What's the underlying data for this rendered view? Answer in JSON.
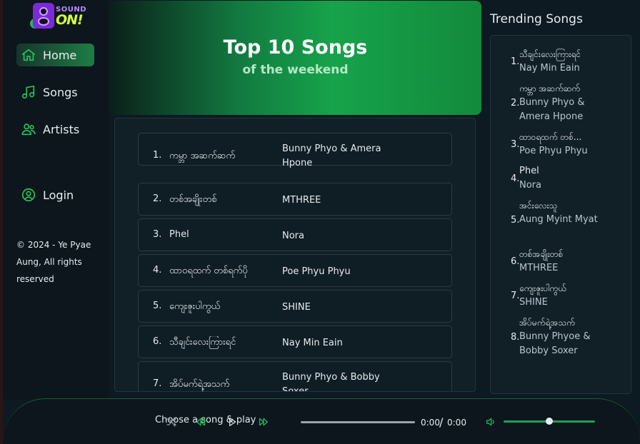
{
  "brand": {
    "line1": "SOUND",
    "line2": "ON!"
  },
  "sidebar": {
    "items": [
      {
        "label": "Home",
        "icon": "home-icon",
        "active": true
      },
      {
        "label": "Songs",
        "icon": "music-note-icon",
        "active": false
      },
      {
        "label": "Artists",
        "icon": "users-icon",
        "active": false
      }
    ],
    "login": {
      "label": "Login",
      "icon": "user-circle-icon"
    },
    "copyright": "© 2024 - Ye Pyae Aung, All rights reserved"
  },
  "hero": {
    "title": "Top 10 Songs",
    "subtitle": "of the weekend"
  },
  "top_songs": [
    {
      "num": "1.",
      "title": "ကမ္ဘာ အဆက်ဆက်",
      "artist": "Bunny Phyo & Amera Hpone"
    },
    {
      "num": "2.",
      "title": "တစ်အချိုးတစ်",
      "artist": "MTHREE"
    },
    {
      "num": "3.",
      "title": "Phel",
      "artist": "Nora"
    },
    {
      "num": "4.",
      "title": "ထာဝရထက် တစ်ရက်ပို",
      "artist": "Poe Phyu Phyu"
    },
    {
      "num": "5.",
      "title": "ကျေးဇူးပါကွယ်",
      "artist": "SHINE"
    },
    {
      "num": "6.",
      "title": "သီချင်းလေးကြားရင်",
      "artist": "Nay Min Eain"
    },
    {
      "num": "7.",
      "title": "အိပ်မက်ရဲ့အသက်",
      "artist": "Bunny Phyo & Bobby Soxer"
    }
  ],
  "trending": {
    "heading": "Trending Songs",
    "items": [
      {
        "num": "1.",
        "title": "သီချင်းလေးကြားရင်",
        "artist": "Nay Min Eain"
      },
      {
        "num": "2.",
        "title": "ကမ္ဘာ အဆက်ဆက်",
        "artist": "Bunny Phyo & Amera Hpone"
      },
      {
        "num": "3.",
        "title": "ထာဝရထက် တစ်...",
        "artist": "Poe Phyu Phyu"
      },
      {
        "num": "4.",
        "title": "Phel",
        "artist": "Nora"
      },
      {
        "num": "5.",
        "title": "အင်းလေးသူ",
        "artist": "Aung Myint Myat"
      },
      {
        "num": "6.",
        "title": "တစ်အချိုးတစ်",
        "artist": "MTHREE"
      },
      {
        "num": "7.",
        "title": "ကျေးဇူးပါကွယ်",
        "artist": "SHINE"
      },
      {
        "num": "8.",
        "title": "အိပ်မက်ရဲ့အသက်",
        "artist": "Bunny Phyoe & Bobby Soxer"
      }
    ]
  },
  "player": {
    "status": "Choose a song & play",
    "current_time": "0:00",
    "separator": "/",
    "duration": "0:00",
    "progress": 0,
    "volume": 0.5
  },
  "colors": {
    "accent": "#22c55e",
    "accent_dark": "#16a34a",
    "background": "#0d1a21"
  }
}
